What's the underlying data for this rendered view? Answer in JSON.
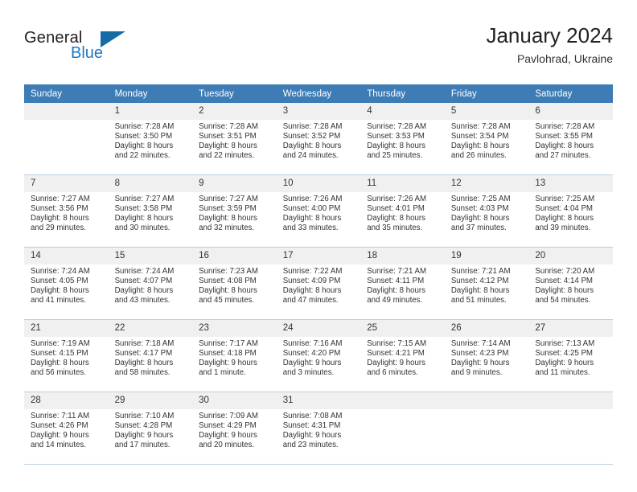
{
  "brand": {
    "name_part1": "General",
    "name_part2": "Blue",
    "triangle_icon": "triangle-icon",
    "accent_color": "#2079c4",
    "triangle_color": "#156BA6"
  },
  "header": {
    "title": "January 2024",
    "subtitle": "Pavlohrad, Ukraine"
  },
  "calendar": {
    "header_bg": "#3D7CB4",
    "daynum_bg": "#f0f0f0",
    "weekdays": [
      "Sunday",
      "Monday",
      "Tuesday",
      "Wednesday",
      "Thursday",
      "Friday",
      "Saturday"
    ],
    "weeks": [
      [
        {
          "day": "",
          "empty": true,
          "sunrise": "",
          "sunset": "",
          "daylight_line1": "",
          "daylight_line2": ""
        },
        {
          "day": "1",
          "sunrise": "Sunrise: 7:28 AM",
          "sunset": "Sunset: 3:50 PM",
          "daylight_line1": "Daylight: 8 hours",
          "daylight_line2": "and 22 minutes."
        },
        {
          "day": "2",
          "sunrise": "Sunrise: 7:28 AM",
          "sunset": "Sunset: 3:51 PM",
          "daylight_line1": "Daylight: 8 hours",
          "daylight_line2": "and 22 minutes."
        },
        {
          "day": "3",
          "sunrise": "Sunrise: 7:28 AM",
          "sunset": "Sunset: 3:52 PM",
          "daylight_line1": "Daylight: 8 hours",
          "daylight_line2": "and 24 minutes."
        },
        {
          "day": "4",
          "sunrise": "Sunrise: 7:28 AM",
          "sunset": "Sunset: 3:53 PM",
          "daylight_line1": "Daylight: 8 hours",
          "daylight_line2": "and 25 minutes."
        },
        {
          "day": "5",
          "sunrise": "Sunrise: 7:28 AM",
          "sunset": "Sunset: 3:54 PM",
          "daylight_line1": "Daylight: 8 hours",
          "daylight_line2": "and 26 minutes."
        },
        {
          "day": "6",
          "sunrise": "Sunrise: 7:28 AM",
          "sunset": "Sunset: 3:55 PM",
          "daylight_line1": "Daylight: 8 hours",
          "daylight_line2": "and 27 minutes."
        }
      ],
      [
        {
          "day": "7",
          "sunrise": "Sunrise: 7:27 AM",
          "sunset": "Sunset: 3:56 PM",
          "daylight_line1": "Daylight: 8 hours",
          "daylight_line2": "and 29 minutes."
        },
        {
          "day": "8",
          "sunrise": "Sunrise: 7:27 AM",
          "sunset": "Sunset: 3:58 PM",
          "daylight_line1": "Daylight: 8 hours",
          "daylight_line2": "and 30 minutes."
        },
        {
          "day": "9",
          "sunrise": "Sunrise: 7:27 AM",
          "sunset": "Sunset: 3:59 PM",
          "daylight_line1": "Daylight: 8 hours",
          "daylight_line2": "and 32 minutes."
        },
        {
          "day": "10",
          "sunrise": "Sunrise: 7:26 AM",
          "sunset": "Sunset: 4:00 PM",
          "daylight_line1": "Daylight: 8 hours",
          "daylight_line2": "and 33 minutes."
        },
        {
          "day": "11",
          "sunrise": "Sunrise: 7:26 AM",
          "sunset": "Sunset: 4:01 PM",
          "daylight_line1": "Daylight: 8 hours",
          "daylight_line2": "and 35 minutes."
        },
        {
          "day": "12",
          "sunrise": "Sunrise: 7:25 AM",
          "sunset": "Sunset: 4:03 PM",
          "daylight_line1": "Daylight: 8 hours",
          "daylight_line2": "and 37 minutes."
        },
        {
          "day": "13",
          "sunrise": "Sunrise: 7:25 AM",
          "sunset": "Sunset: 4:04 PM",
          "daylight_line1": "Daylight: 8 hours",
          "daylight_line2": "and 39 minutes."
        }
      ],
      [
        {
          "day": "14",
          "sunrise": "Sunrise: 7:24 AM",
          "sunset": "Sunset: 4:05 PM",
          "daylight_line1": "Daylight: 8 hours",
          "daylight_line2": "and 41 minutes."
        },
        {
          "day": "15",
          "sunrise": "Sunrise: 7:24 AM",
          "sunset": "Sunset: 4:07 PM",
          "daylight_line1": "Daylight: 8 hours",
          "daylight_line2": "and 43 minutes."
        },
        {
          "day": "16",
          "sunrise": "Sunrise: 7:23 AM",
          "sunset": "Sunset: 4:08 PM",
          "daylight_line1": "Daylight: 8 hours",
          "daylight_line2": "and 45 minutes."
        },
        {
          "day": "17",
          "sunrise": "Sunrise: 7:22 AM",
          "sunset": "Sunset: 4:09 PM",
          "daylight_line1": "Daylight: 8 hours",
          "daylight_line2": "and 47 minutes."
        },
        {
          "day": "18",
          "sunrise": "Sunrise: 7:21 AM",
          "sunset": "Sunset: 4:11 PM",
          "daylight_line1": "Daylight: 8 hours",
          "daylight_line2": "and 49 minutes."
        },
        {
          "day": "19",
          "sunrise": "Sunrise: 7:21 AM",
          "sunset": "Sunset: 4:12 PM",
          "daylight_line1": "Daylight: 8 hours",
          "daylight_line2": "and 51 minutes."
        },
        {
          "day": "20",
          "sunrise": "Sunrise: 7:20 AM",
          "sunset": "Sunset: 4:14 PM",
          "daylight_line1": "Daylight: 8 hours",
          "daylight_line2": "and 54 minutes."
        }
      ],
      [
        {
          "day": "21",
          "sunrise": "Sunrise: 7:19 AM",
          "sunset": "Sunset: 4:15 PM",
          "daylight_line1": "Daylight: 8 hours",
          "daylight_line2": "and 56 minutes."
        },
        {
          "day": "22",
          "sunrise": "Sunrise: 7:18 AM",
          "sunset": "Sunset: 4:17 PM",
          "daylight_line1": "Daylight: 8 hours",
          "daylight_line2": "and 58 minutes."
        },
        {
          "day": "23",
          "sunrise": "Sunrise: 7:17 AM",
          "sunset": "Sunset: 4:18 PM",
          "daylight_line1": "Daylight: 9 hours",
          "daylight_line2": "and 1 minute."
        },
        {
          "day": "24",
          "sunrise": "Sunrise: 7:16 AM",
          "sunset": "Sunset: 4:20 PM",
          "daylight_line1": "Daylight: 9 hours",
          "daylight_line2": "and 3 minutes."
        },
        {
          "day": "25",
          "sunrise": "Sunrise: 7:15 AM",
          "sunset": "Sunset: 4:21 PM",
          "daylight_line1": "Daylight: 9 hours",
          "daylight_line2": "and 6 minutes."
        },
        {
          "day": "26",
          "sunrise": "Sunrise: 7:14 AM",
          "sunset": "Sunset: 4:23 PM",
          "daylight_line1": "Daylight: 9 hours",
          "daylight_line2": "and 9 minutes."
        },
        {
          "day": "27",
          "sunrise": "Sunrise: 7:13 AM",
          "sunset": "Sunset: 4:25 PM",
          "daylight_line1": "Daylight: 9 hours",
          "daylight_line2": "and 11 minutes."
        }
      ],
      [
        {
          "day": "28",
          "sunrise": "Sunrise: 7:11 AM",
          "sunset": "Sunset: 4:26 PM",
          "daylight_line1": "Daylight: 9 hours",
          "daylight_line2": "and 14 minutes."
        },
        {
          "day": "29",
          "sunrise": "Sunrise: 7:10 AM",
          "sunset": "Sunset: 4:28 PM",
          "daylight_line1": "Daylight: 9 hours",
          "daylight_line2": "and 17 minutes."
        },
        {
          "day": "30",
          "sunrise": "Sunrise: 7:09 AM",
          "sunset": "Sunset: 4:29 PM",
          "daylight_line1": "Daylight: 9 hours",
          "daylight_line2": "and 20 minutes."
        },
        {
          "day": "31",
          "sunrise": "Sunrise: 7:08 AM",
          "sunset": "Sunset: 4:31 PM",
          "daylight_line1": "Daylight: 9 hours",
          "daylight_line2": "and 23 minutes."
        },
        {
          "day": "",
          "empty": true,
          "sunrise": "",
          "sunset": "",
          "daylight_line1": "",
          "daylight_line2": ""
        },
        {
          "day": "",
          "empty": true,
          "sunrise": "",
          "sunset": "",
          "daylight_line1": "",
          "daylight_line2": ""
        },
        {
          "day": "",
          "empty": true,
          "sunrise": "",
          "sunset": "",
          "daylight_line1": "",
          "daylight_line2": ""
        }
      ]
    ]
  }
}
